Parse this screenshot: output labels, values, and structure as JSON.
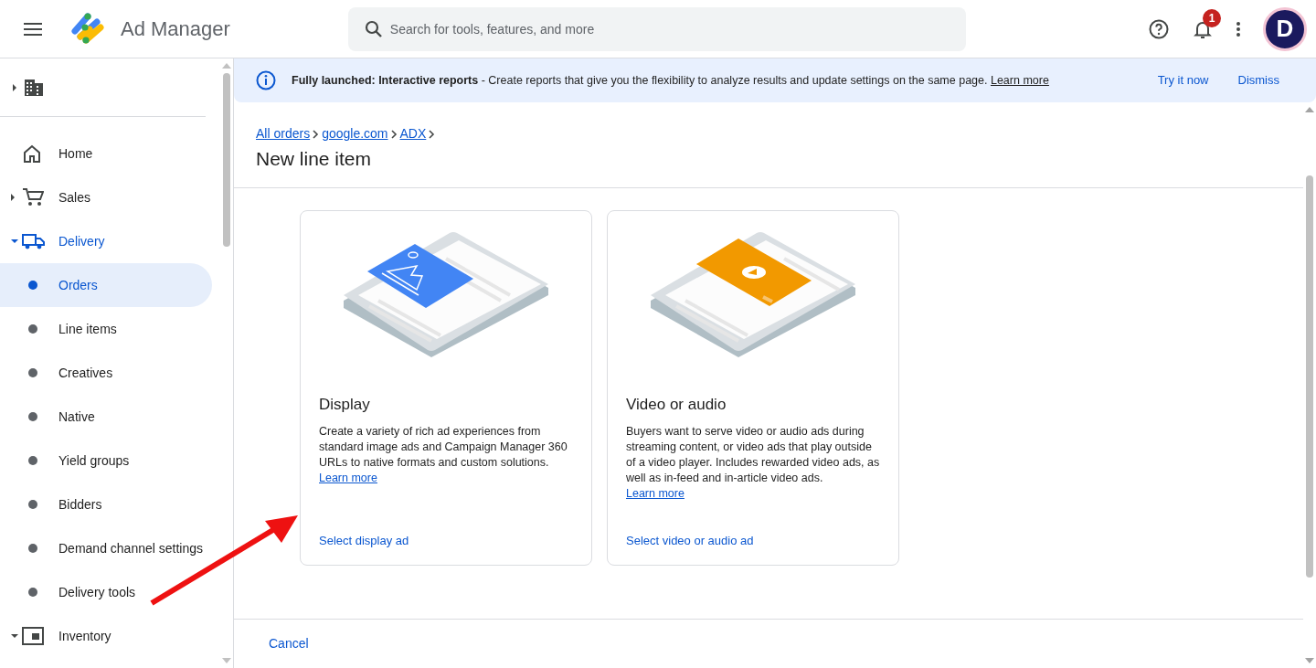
{
  "header": {
    "product": "Ad Manager",
    "search_placeholder": "Search for tools, features, and more",
    "notification_count": "1",
    "avatar_letter": "D"
  },
  "sidebar": {
    "items": [
      {
        "label": "Home",
        "kind": "section",
        "selected": false
      },
      {
        "label": "Sales",
        "kind": "section",
        "expanded": false,
        "selected": false
      },
      {
        "label": "Delivery",
        "kind": "section",
        "expanded": true,
        "selected": true,
        "children": [
          {
            "label": "Orders",
            "selected": true
          },
          {
            "label": "Line items",
            "selected": false
          },
          {
            "label": "Creatives",
            "selected": false
          },
          {
            "label": "Native",
            "selected": false
          },
          {
            "label": "Yield groups",
            "selected": false
          },
          {
            "label": "Bidders",
            "selected": false
          },
          {
            "label": "Demand channel settings",
            "selected": false
          },
          {
            "label": "Delivery tools",
            "selected": false
          }
        ]
      },
      {
        "label": "Inventory",
        "kind": "section",
        "expanded": true,
        "selected": false
      }
    ]
  },
  "banner": {
    "title": "Fully launched: Interactive reports",
    "text": " - Create reports that give you the flexibility to analyze results and update settings on the same page. ",
    "link": "Learn more",
    "actions": [
      "Try it now",
      "Dismiss"
    ]
  },
  "breadcrumb": [
    "All orders",
    "google.com",
    "ADX"
  ],
  "page_title": "New line item",
  "cards": [
    {
      "kind": "display",
      "title": "Display",
      "description": "Create a variety of rich ad experiences from standard image ads and Campaign Manager 360 URLs to native formats and custom solutions. ",
      "link": "Learn more",
      "action": "Select display ad"
    },
    {
      "kind": "video",
      "title": "Video or audio",
      "description": "Buyers want to serve video or audio ads during streaming content, or video ads that play outside of a video player. Includes rewarded video ads, as well as in-feed and in-article video ads. ",
      "link": "Learn more",
      "action": "Select video or audio ad"
    }
  ],
  "footer": {
    "cancel": "Cancel"
  }
}
